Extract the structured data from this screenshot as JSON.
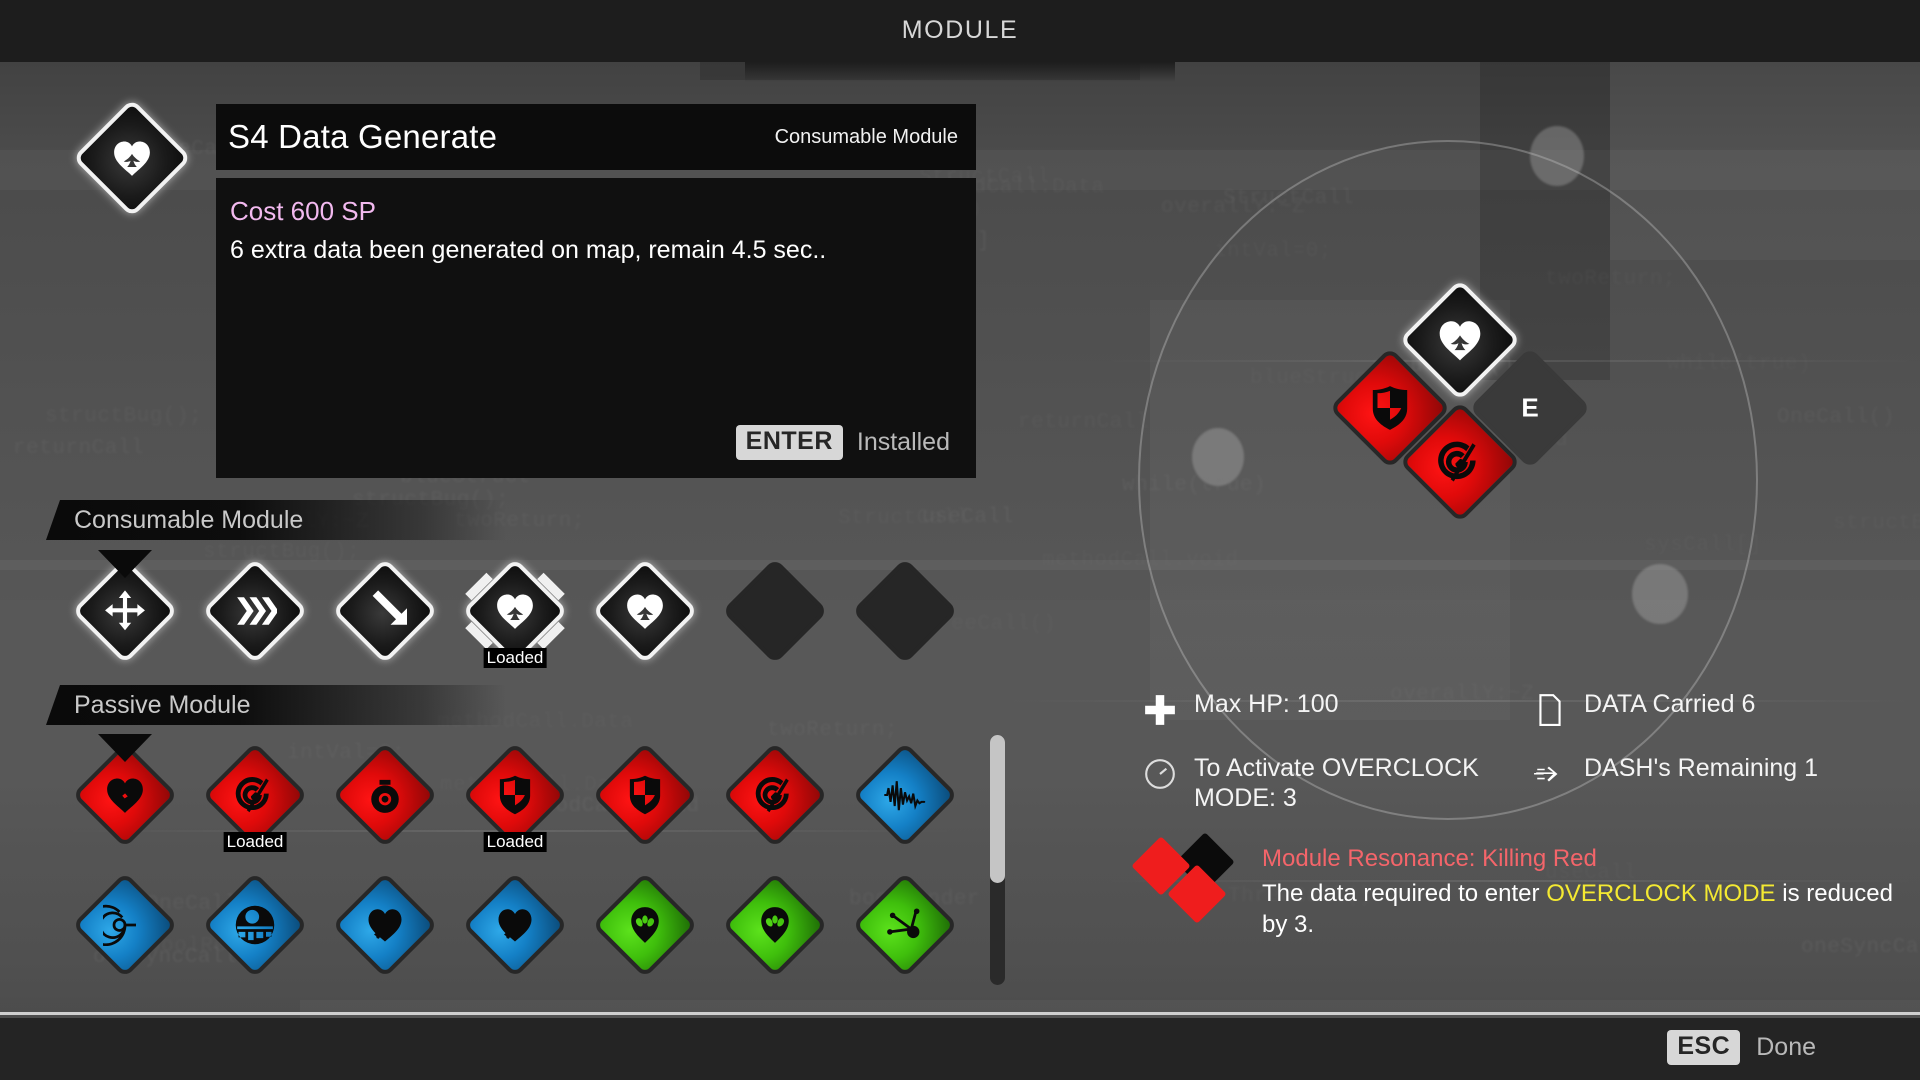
{
  "header": {
    "title": "MODULE"
  },
  "detail": {
    "icon": "heart-spade-icon",
    "name": "S4 Data Generate",
    "type": "Consumable Module",
    "cost": "Cost 600 SP",
    "description": "6 extra data been generated on map, remain 4.5 sec..",
    "action_key": "ENTER",
    "action_label": "Installed"
  },
  "sections": {
    "consumable_label": "Consumable Module",
    "passive_label": "Passive Module"
  },
  "consumable_slots": [
    {
      "icon": "move-arrows-icon",
      "color": "white",
      "state": "selected",
      "tag": ""
    },
    {
      "icon": "chevrons-right-icon",
      "color": "white",
      "state": "normal",
      "tag": ""
    },
    {
      "icon": "arrow-down-right-icon",
      "color": "white",
      "state": "normal",
      "tag": ""
    },
    {
      "icon": "heart-spade-icon",
      "color": "white",
      "state": "equipped",
      "tag": "Loaded"
    },
    {
      "icon": "heart-spade-icon",
      "color": "white",
      "state": "normal",
      "tag": ""
    },
    {
      "icon": "",
      "color": "empty",
      "state": "empty",
      "tag": ""
    },
    {
      "icon": "",
      "color": "empty",
      "state": "empty",
      "tag": ""
    }
  ],
  "passive_slots_row1": [
    {
      "icon": "heart-broken-icon",
      "color": "red",
      "state": "selected",
      "tag": ""
    },
    {
      "icon": "radar-slash-icon",
      "color": "red",
      "state": "normal",
      "tag": "Loaded"
    },
    {
      "icon": "bomb-icon",
      "color": "red",
      "state": "normal",
      "tag": ""
    },
    {
      "icon": "shield-quartered-icon",
      "color": "red",
      "state": "normal",
      "tag": "Loaded"
    },
    {
      "icon": "shield-quartered-icon",
      "color": "red",
      "state": "normal",
      "tag": ""
    },
    {
      "icon": "radar-slash-icon",
      "color": "red",
      "state": "normal",
      "tag": ""
    },
    {
      "icon": "waveform-icon",
      "color": "blue",
      "state": "normal",
      "tag": ""
    }
  ],
  "passive_slots_row2": [
    {
      "icon": "sonar-icon",
      "color": "blue",
      "state": "normal",
      "tag": ""
    },
    {
      "icon": "death-star-icon",
      "color": "blue",
      "state": "normal",
      "tag": ""
    },
    {
      "icon": "heart-gear-icon",
      "color": "blue",
      "state": "normal",
      "tag": ""
    },
    {
      "icon": "heart-gear-icon",
      "color": "blue",
      "state": "normal",
      "tag": ""
    },
    {
      "icon": "alien-head-icon",
      "color": "green",
      "state": "normal",
      "tag": ""
    },
    {
      "icon": "alien-head-icon",
      "color": "green",
      "state": "normal",
      "tag": ""
    },
    {
      "icon": "molecule-icon",
      "color": "green",
      "state": "normal",
      "tag": ""
    }
  ],
  "equipped": [
    {
      "icon": "heart-spade-icon",
      "color": "white",
      "key": ""
    },
    {
      "icon": "shield-quartered-icon",
      "color": "red",
      "key": ""
    },
    {
      "icon": "radar-slash-icon",
      "color": "red",
      "key": ""
    },
    {
      "icon": "",
      "color": "dark",
      "key": "E"
    }
  ],
  "stats": [
    {
      "icon": "health-cross-icon",
      "text": "Max HP: 100"
    },
    {
      "icon": "data-file-icon",
      "text": "DATA Carried 6"
    },
    {
      "icon": "gauge-icon",
      "text": "To Activate OVERCLOCK MODE: 3"
    },
    {
      "icon": "dash-icon",
      "text": "DASH's Remaining 1"
    }
  ],
  "resonance": {
    "icon": "resonance-diamonds-icon",
    "title": "Module Resonance: Killing Red",
    "desc_part1": "The data required to enter ",
    "desc_highlight1": "OVERCLOCK MODE",
    "desc_part2": " is reduced by 3."
  },
  "footer": {
    "key": "ESC",
    "label": "Done"
  },
  "colors": {
    "accent_pink": "#f2b9ef",
    "resonance_red": "#f4656a",
    "highlight_yellow": "#f4e932",
    "module_red": "#ef1d1d",
    "module_blue": "#1480c6",
    "module_green": "#3fbf0c"
  },
  "background_code": [
    "ThreeCall()",
    "twoReturn;",
    "OneCall()",
    "useCall",
    "StructCall",
    "methodCall.Data",
    "methodCall.void",
    "oneSyncCall",
    "overallY:~Z",
    "structBug();",
    "blueStruct",
    "structBug()",
    "returnCall",
    "methodVoid",
    "boolRender",
    "sysCall[]",
    "while(true)",
    "intVal=0;"
  ]
}
